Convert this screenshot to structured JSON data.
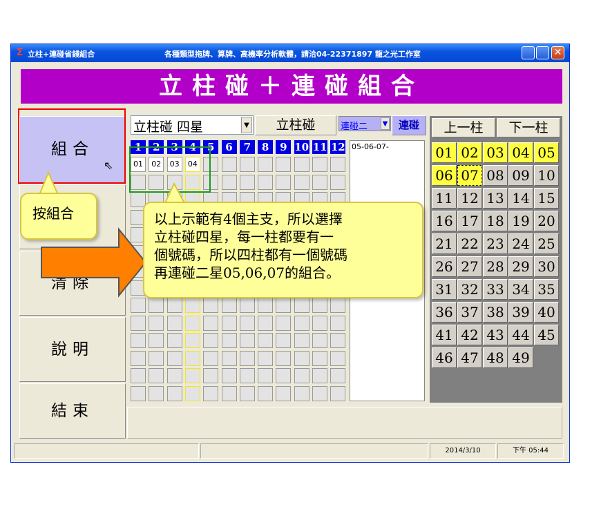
{
  "window": {
    "title": "立柱+連碰省錢組合",
    "subtitle": "各種類型拖牌、算牌、高機率分析軟體，請洽04-22371897 龍之光工作室",
    "app_icon": "sigma-icon"
  },
  "banner": "立柱碰＋連碰組合",
  "left_buttons": [
    "組合",
    "",
    "清除",
    "說明",
    "結束"
  ],
  "mode_dropdown": {
    "value": "立柱碰 四星"
  },
  "mode_button": "立柱碰",
  "link_dropdown": {
    "value": "連碰二",
    "button": "連碰"
  },
  "column_numbers": [
    "1",
    "2",
    "3",
    "4",
    "5",
    "6",
    "7",
    "8",
    "9",
    "10",
    "11",
    "12"
  ],
  "grid_row1": [
    "01",
    "02",
    "03",
    "04"
  ],
  "list_text": "05-06-07-",
  "prev_button": "上一柱",
  "next_button": "下一柱",
  "numbers": [
    "01",
    "02",
    "03",
    "04",
    "05",
    "06",
    "07",
    "08",
    "09",
    "10",
    "11",
    "12",
    "13",
    "14",
    "15",
    "16",
    "17",
    "18",
    "19",
    "20",
    "21",
    "22",
    "23",
    "24",
    "25",
    "26",
    "27",
    "28",
    "29",
    "30",
    "31",
    "32",
    "33",
    "34",
    "35",
    "36",
    "37",
    "38",
    "39",
    "40",
    "41",
    "42",
    "43",
    "44",
    "45",
    "46",
    "47",
    "48",
    "49"
  ],
  "highlighted": [
    "01",
    "02",
    "03",
    "04",
    "05",
    "06",
    "07"
  ],
  "status": {
    "date": "2014/3/10",
    "time": "下午 05:44"
  },
  "callout_small": "按組合",
  "callout_large": [
    "以上示範有4個主支，所以選擇",
    "立柱碰四星，每一柱都要有一",
    "個號碼，所以四柱都有一個號碼",
    "再連碰二星05,06,07的組合。"
  ],
  "colors": {
    "banner": "#b200c8",
    "highlight": "#ffff40",
    "column_header": "#0000e0"
  }
}
